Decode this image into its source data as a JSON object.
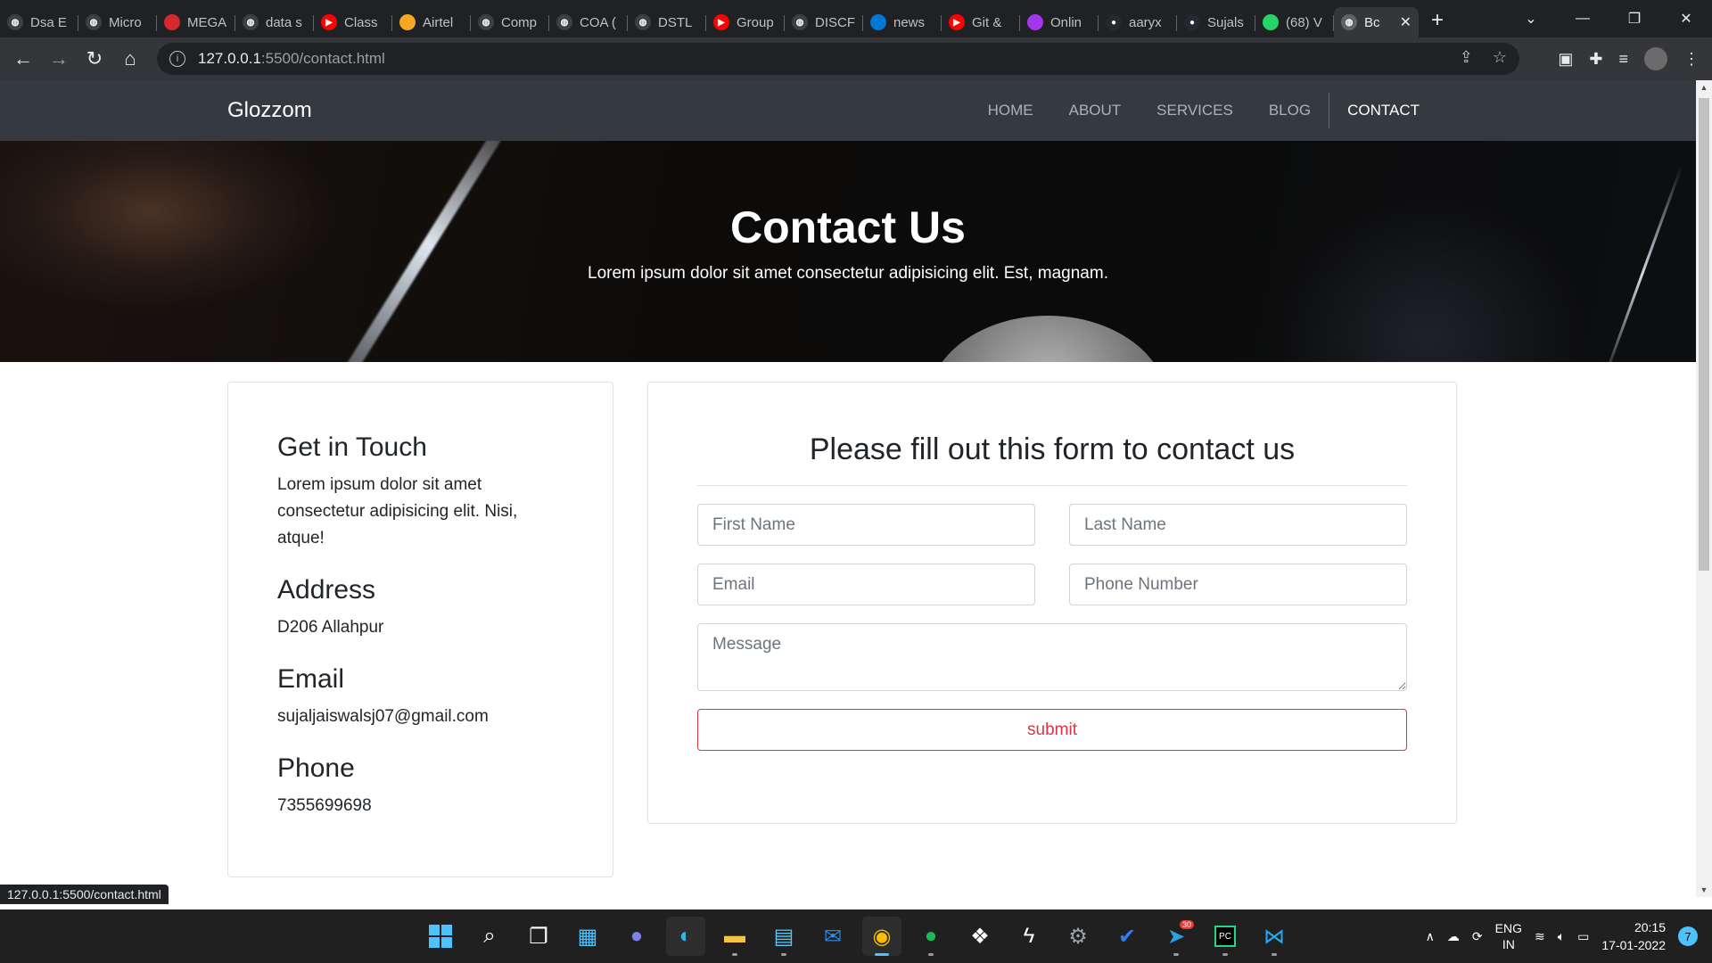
{
  "browser": {
    "tabs": [
      {
        "label": "Dsa E",
        "icon": "globe-icon",
        "color": "#3c4043"
      },
      {
        "label": "Micro",
        "icon": "globe-icon",
        "color": "#3c4043"
      },
      {
        "label": "MEGA",
        "icon": "mega-icon",
        "color": "#d9272e"
      },
      {
        "label": "data s",
        "icon": "globe-icon",
        "color": "#3c4043"
      },
      {
        "label": "Class",
        "icon": "youtube-icon",
        "color": "#ff0000"
      },
      {
        "label": "Airtel",
        "icon": "airtel-icon",
        "color": "#f5a623"
      },
      {
        "label": "Comp",
        "icon": "globe-icon",
        "color": "#3c4043"
      },
      {
        "label": "COA (",
        "icon": "globe-icon",
        "color": "#3c4043"
      },
      {
        "label": "DSTL",
        "icon": "globe-icon",
        "color": "#3c4043"
      },
      {
        "label": "Group",
        "icon": "youtube-icon",
        "color": "#ff0000"
      },
      {
        "label": "DISCF",
        "icon": "globe-icon",
        "color": "#3c4043"
      },
      {
        "label": "news",
        "icon": "azure-icon",
        "color": "#0078d4"
      },
      {
        "label": "Git &",
        "icon": "youtube-icon",
        "color": "#ff0000"
      },
      {
        "label": "Onlin",
        "icon": "udemy-icon",
        "color": "#a435f0"
      },
      {
        "label": "aaryx",
        "icon": "github-icon",
        "color": "#24292e"
      },
      {
        "label": "Sujals",
        "icon": "github-icon",
        "color": "#24292e"
      },
      {
        "label": "(68) V",
        "icon": "whatsapp-icon",
        "color": "#25d366"
      }
    ],
    "active_tab": {
      "label": "Bc",
      "icon": "globe-icon"
    },
    "url_host": "127.0.0.1",
    "url_path": ":5500/contact.html",
    "status_url": "127.0.0.1:5500/contact.html"
  },
  "site": {
    "brand": "Glozzom",
    "nav": [
      "HOME",
      "ABOUT",
      "SERVICES",
      "BLOG",
      "CONTACT"
    ],
    "hero": {
      "title": "Contact Us",
      "subtitle": "Lorem ipsum dolor sit amet consectetur adipisicing elit. Est, magnam."
    },
    "info": {
      "heading": "Get in Touch",
      "text": "Lorem ipsum dolor sit amet consectetur adipisicing elit. Nisi, atque!",
      "address_heading": "Address",
      "address": "D206 Allahpur",
      "email_heading": "Email",
      "email": "sujaljaiswalsj07@gmail.com",
      "phone_heading": "Phone",
      "phone": "7355699698"
    },
    "form": {
      "heading": "Please fill out this form to contact us",
      "first_name_placeholder": "First Name",
      "last_name_placeholder": "Last Name",
      "email_placeholder": "Email",
      "phone_placeholder": "Phone Number",
      "message_placeholder": "Message",
      "submit_label": "submit"
    }
  },
  "taskbar": {
    "lang_top": "ENG",
    "lang_bottom": "IN",
    "time": "20:15",
    "date": "17-01-2022",
    "notification_count": "7",
    "telegram_badge": "30"
  },
  "colors": {
    "navbar_bg": "#343a40",
    "submit_accent": "#dc3545",
    "chrome_dark": "#202124"
  }
}
